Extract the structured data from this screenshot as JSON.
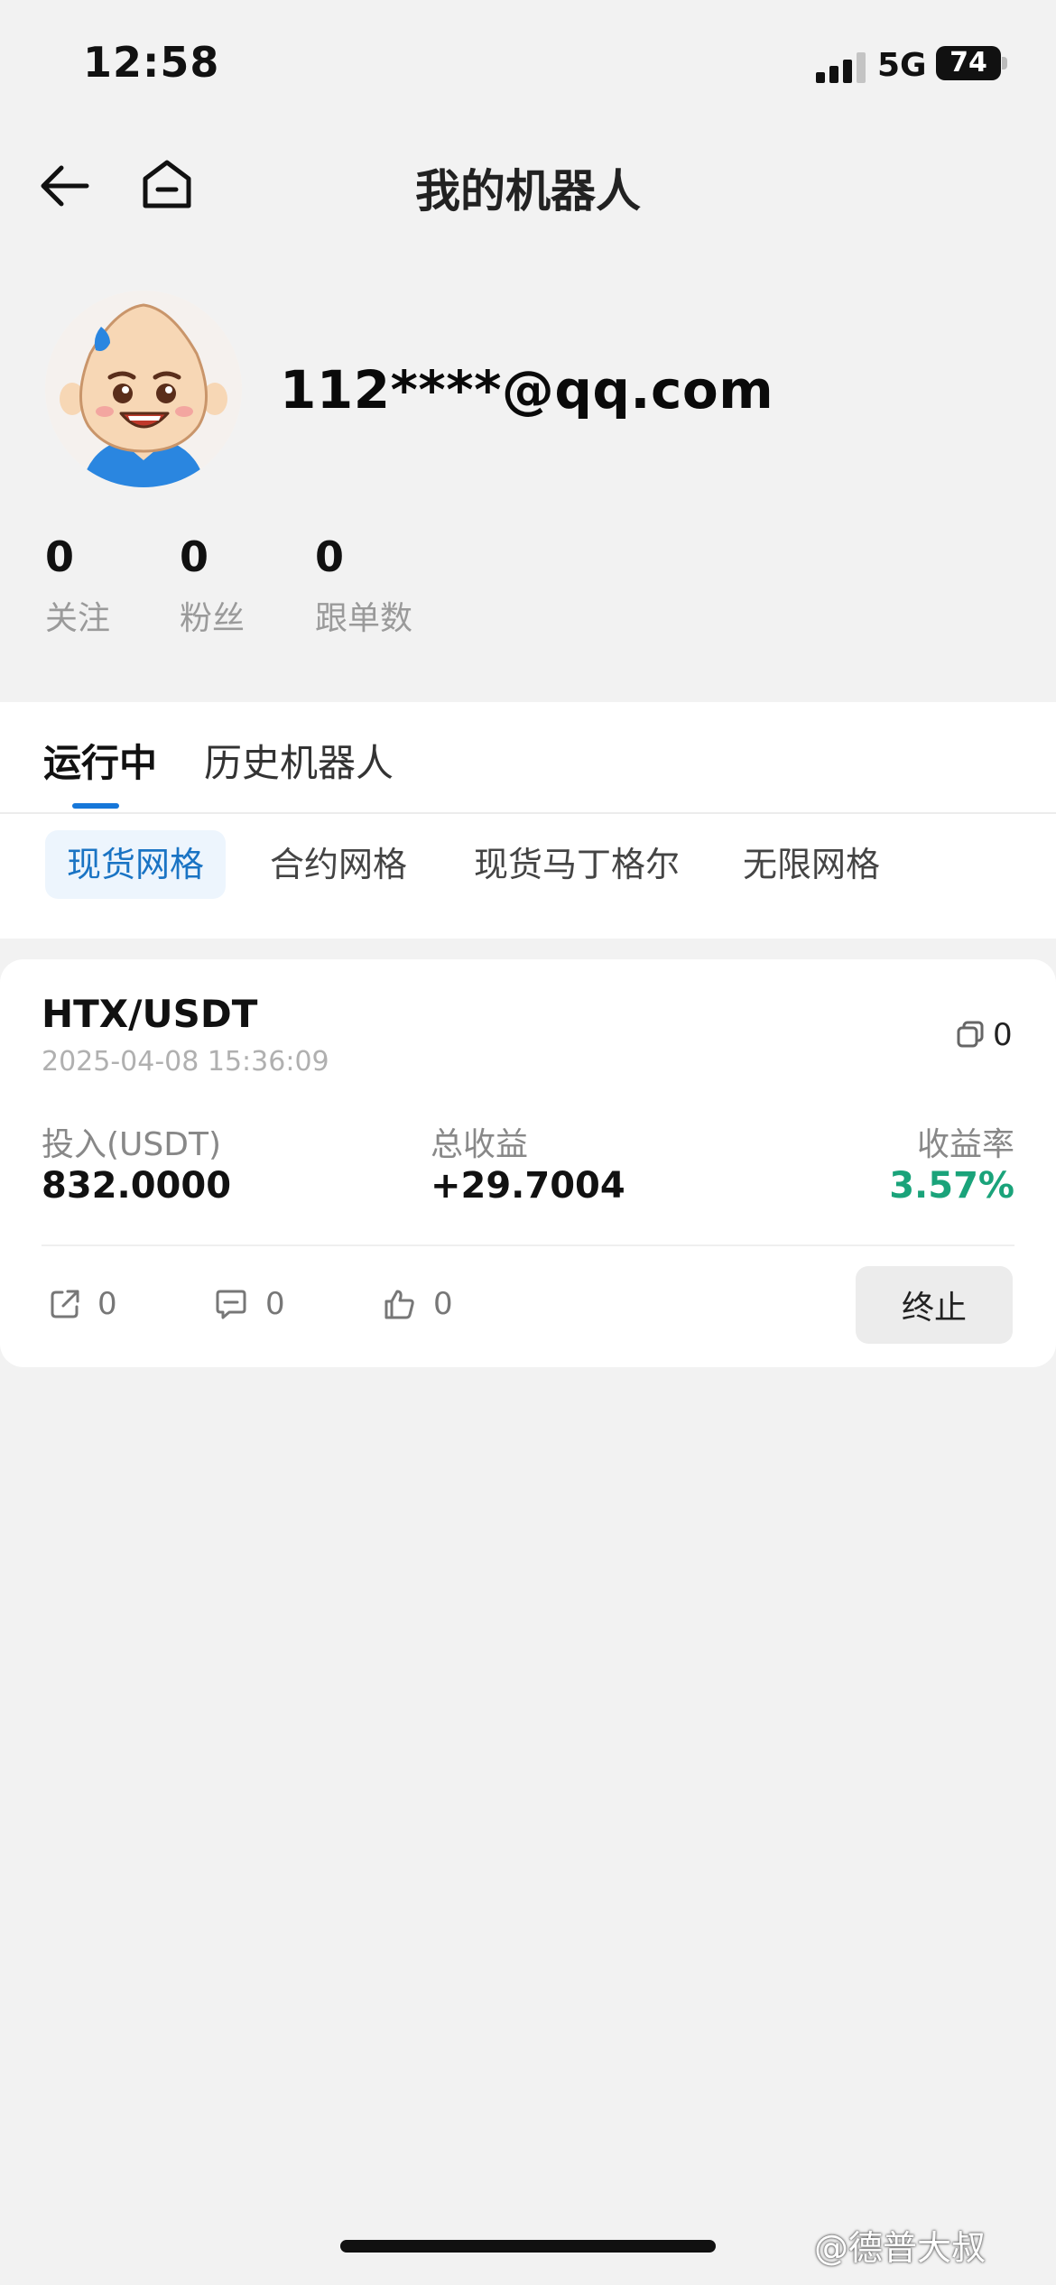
{
  "status_bar": {
    "time": "12:58",
    "network": "5G",
    "battery": "74"
  },
  "nav": {
    "title": "我的机器人",
    "back_icon": "arrow-left-icon",
    "home_icon": "home-icon"
  },
  "profile": {
    "email": "112****@qq.com",
    "avatar_icon": "cartoon-baby-avatar",
    "stats": [
      {
        "value": "0",
        "label": "关注"
      },
      {
        "value": "0",
        "label": "粉丝"
      },
      {
        "value": "0",
        "label": "跟单数"
      }
    ]
  },
  "tabs": {
    "items": [
      "运行中",
      "历史机器人"
    ],
    "active_index": 0
  },
  "filters": {
    "items": [
      "现货网格",
      "合约网格",
      "现货马丁格尔",
      "无限网格"
    ],
    "active_index": 0
  },
  "bot_card": {
    "pair": "HTX/USDT",
    "created": "2025-04-08 15:36:09",
    "copy_count": "0",
    "invest_label": "投入(USDT)",
    "invest_value": "832.0000",
    "profit_label": "总收益",
    "profit_value": "+29.7004",
    "rate_label": "收益率",
    "rate_value": "3.57%",
    "share_count": "0",
    "comment_count": "0",
    "like_count": "0",
    "stop_label": "终止"
  },
  "watermark": "@德普大叔",
  "colors": {
    "accent_blue": "#1677d9",
    "profit_green": "#1aa37a",
    "background": "#f2f2f2"
  }
}
